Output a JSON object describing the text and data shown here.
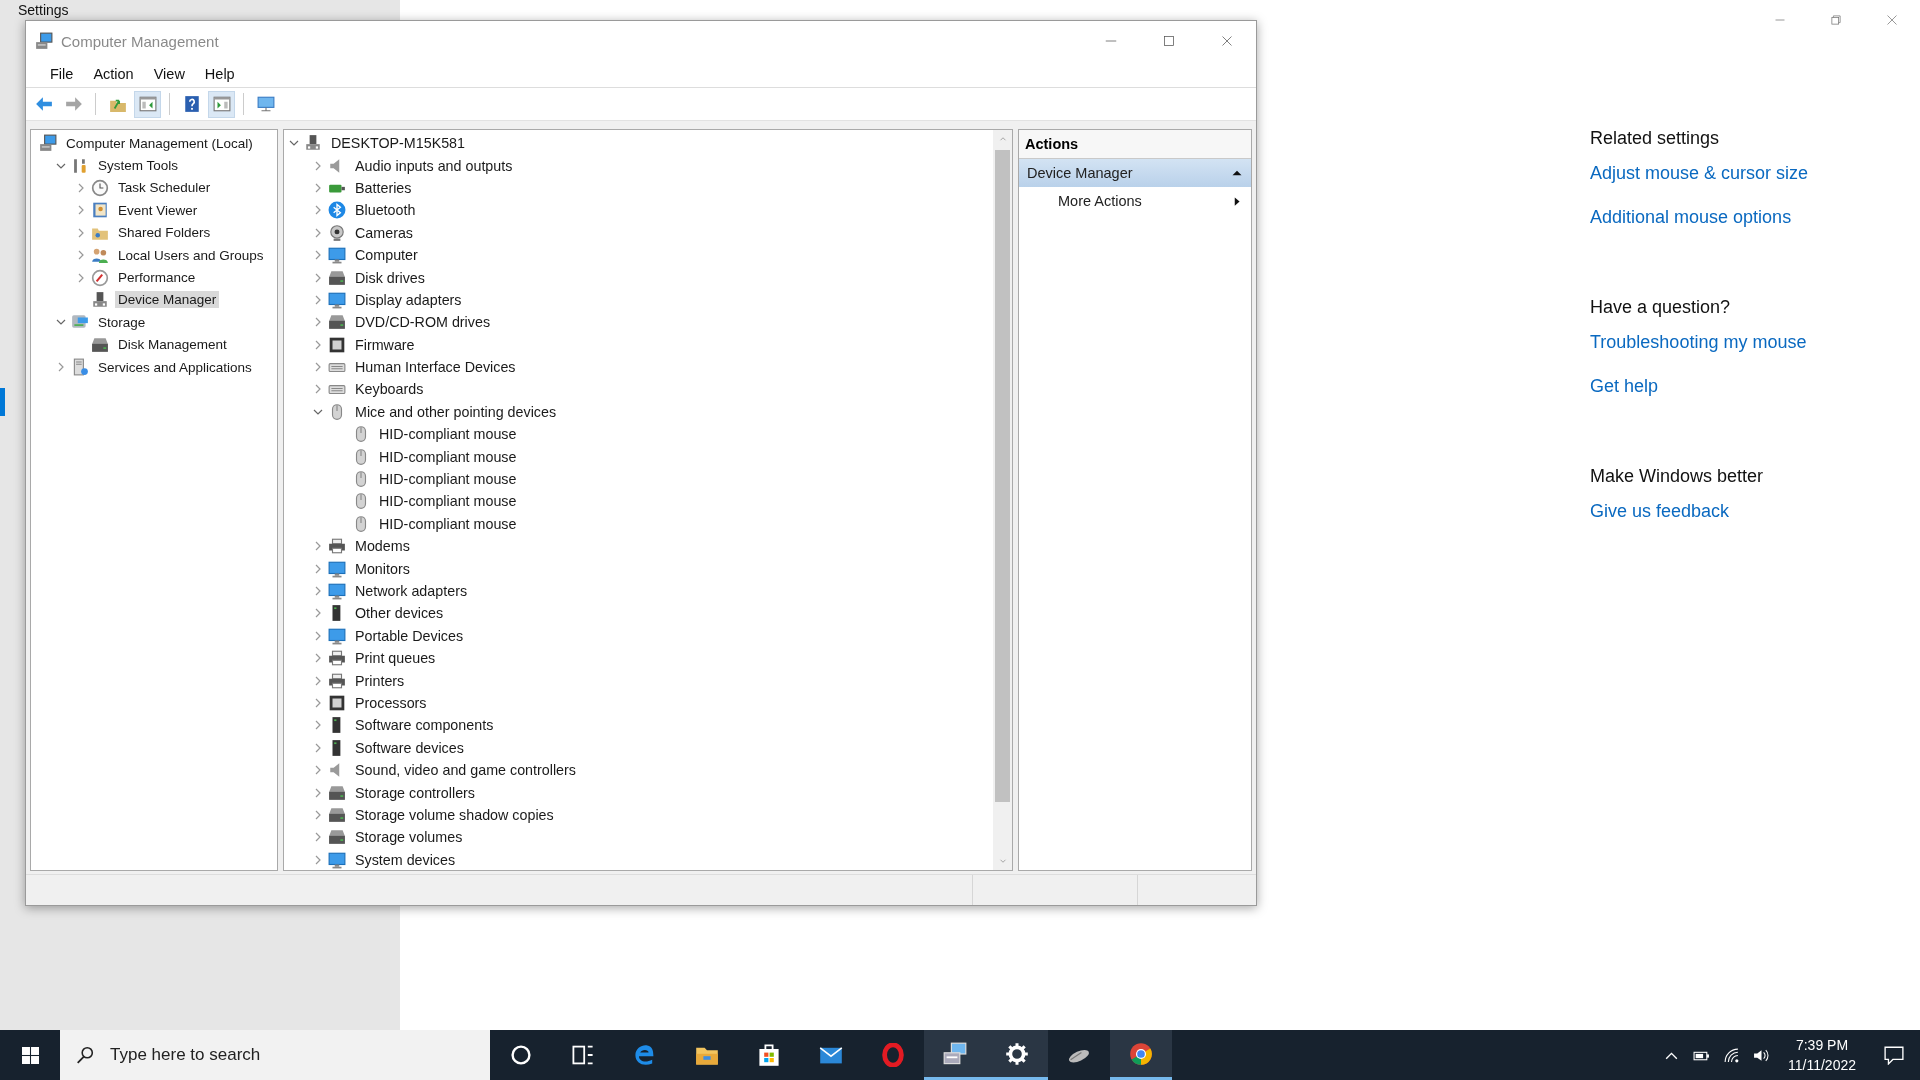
{
  "settings": {
    "title": "Settings",
    "nav_selected_marker": true,
    "sections": [
      {
        "heading": "Related settings",
        "links": [
          "Adjust mouse & cursor size",
          "Additional mouse options"
        ]
      },
      {
        "heading": "Have a question?",
        "links": [
          "Troubleshooting my mouse",
          "Get help"
        ]
      },
      {
        "heading": "Make Windows better",
        "links": [
          "Give us feedback"
        ]
      }
    ]
  },
  "window": {
    "title": "Computer Management",
    "menu": [
      "File",
      "Action",
      "View",
      "Help"
    ],
    "toolbar": [
      {
        "kind": "back",
        "pressed": false,
        "disabled": false
      },
      {
        "kind": "forward",
        "pressed": false,
        "disabled": true
      },
      {
        "kind": "up",
        "pressed": false,
        "disabled": false
      },
      {
        "kind": "tree_pane",
        "pressed": true,
        "disabled": false
      },
      {
        "kind": "help",
        "pressed": false,
        "disabled": false
      },
      {
        "kind": "action_pane",
        "pressed": true,
        "disabled": false
      },
      {
        "kind": "monitor",
        "pressed": false,
        "disabled": false
      }
    ],
    "console_tree": [
      {
        "label": "Computer Management (Local)",
        "selected": false,
        "children": [
          {
            "label": "System Tools",
            "expanded": true,
            "selected": false,
            "children": [
              {
                "label": "Task Scheduler",
                "expanded": false,
                "selected": false
              },
              {
                "label": "Event Viewer",
                "expanded": false,
                "selected": false
              },
              {
                "label": "Shared Folders",
                "expanded": false,
                "selected": false
              },
              {
                "label": "Local Users and Groups",
                "expanded": false,
                "selected": false
              },
              {
                "label": "Performance",
                "expanded": false,
                "selected": false
              },
              {
                "label": "Device Manager",
                "selected": true
              }
            ]
          },
          {
            "label": "Storage",
            "expanded": true,
            "selected": false,
            "children": [
              {
                "label": "Disk Management",
                "selected": false
              }
            ]
          },
          {
            "label": "Services and Applications",
            "expanded": false,
            "selected": false
          }
        ]
      }
    ],
    "device_tree": [
      {
        "label": "DESKTOP-M15K581",
        "expanded": true,
        "selected": false,
        "children": [
          {
            "label": "Audio inputs and outputs",
            "expanded": false,
            "selected": false
          },
          {
            "label": "Batteries",
            "expanded": false,
            "selected": false
          },
          {
            "label": "Bluetooth",
            "expanded": false,
            "selected": false
          },
          {
            "label": "Cameras",
            "expanded": false,
            "selected": false
          },
          {
            "label": "Computer",
            "expanded": false,
            "selected": false
          },
          {
            "label": "Disk drives",
            "expanded": false,
            "selected": false
          },
          {
            "label": "Display adapters",
            "expanded": false,
            "selected": false
          },
          {
            "label": "DVD/CD-ROM drives",
            "expanded": false,
            "selected": false
          },
          {
            "label": "Firmware",
            "expanded": false,
            "selected": false
          },
          {
            "label": "Human Interface Devices",
            "expanded": false,
            "selected": false
          },
          {
            "label": "Keyboards",
            "expanded": false,
            "selected": false
          },
          {
            "label": "Mice and other pointing devices",
            "expanded": true,
            "selected": false,
            "children": [
              {
                "label": "HID-compliant mouse",
                "selected": false
              },
              {
                "label": "HID-compliant mouse",
                "selected": false
              },
              {
                "label": "HID-compliant mouse",
                "selected": false
              },
              {
                "label": "HID-compliant mouse",
                "selected": false
              },
              {
                "label": "HID-compliant mouse",
                "selected": false
              }
            ]
          },
          {
            "label": "Modems",
            "expanded": false,
            "selected": false
          },
          {
            "label": "Monitors",
            "expanded": false,
            "selected": false
          },
          {
            "label": "Network adapters",
            "expanded": false,
            "selected": false
          },
          {
            "label": "Other devices",
            "expanded": false,
            "selected": false
          },
          {
            "label": "Portable Devices",
            "expanded": false,
            "selected": false
          },
          {
            "label": "Print queues",
            "expanded": false,
            "selected": false
          },
          {
            "label": "Printers",
            "expanded": false,
            "selected": false
          },
          {
            "label": "Processors",
            "expanded": false,
            "selected": false
          },
          {
            "label": "Software components",
            "expanded": false,
            "selected": false
          },
          {
            "label": "Software devices",
            "expanded": false,
            "selected": false
          },
          {
            "label": "Sound, video and game controllers",
            "expanded": false,
            "selected": false
          },
          {
            "label": "Storage controllers",
            "expanded": false,
            "selected": false
          },
          {
            "label": "Storage volume shadow copies",
            "expanded": false,
            "selected": false
          },
          {
            "label": "Storage volumes",
            "expanded": false,
            "selected": false
          },
          {
            "label": "System devices",
            "expanded": false,
            "selected": false
          }
        ]
      }
    ],
    "actions": {
      "title": "Actions",
      "section": {
        "label": "Device Manager",
        "expanded": true
      },
      "items": [
        "More Actions"
      ]
    }
  },
  "taskbar": {
    "search_placeholder": "Type here to search",
    "apps": [
      {
        "kind": "cortana",
        "running": false
      },
      {
        "kind": "task_view",
        "running": false
      },
      {
        "kind": "edge",
        "running": false
      },
      {
        "kind": "explorer",
        "running": false
      },
      {
        "kind": "store",
        "running": false
      },
      {
        "kind": "mail",
        "running": false
      },
      {
        "kind": "opera",
        "running": false
      },
      {
        "kind": "computer",
        "running": true
      },
      {
        "kind": "settings",
        "running": true
      },
      {
        "kind": "mouse",
        "running": false
      },
      {
        "kind": "chrome",
        "running": true
      }
    ],
    "time": "7:39 PM",
    "date": "11/11/2022"
  }
}
